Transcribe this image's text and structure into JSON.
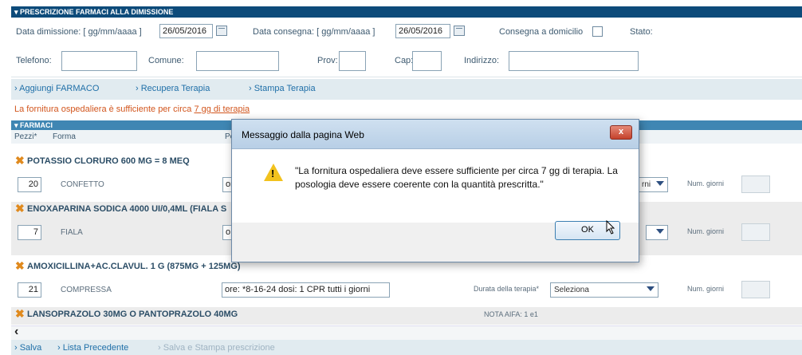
{
  "header": {
    "title": "▾ PRESCRIZIONE FARMACI ALLA DIMISSIONE"
  },
  "dimissione": {
    "data_dimissione_label": "Data dimissione: [ gg/mm/aaaa ]",
    "data_dimissione_value": "26/05/2016",
    "data_consegna_label": "Data consegna: [ gg/mm/aaaa ]",
    "data_consegna_value": "26/05/2016",
    "consegna_domicilio_label": "Consegna a domicilio",
    "stato_label": "Stato:",
    "telefono_label": "Telefono:",
    "comune_label": "Comune:",
    "prov_label": "Prov:",
    "cap_label": "Cap:",
    "indirizzo_label": "Indirizzo:"
  },
  "actions": {
    "aggiungi": "› Aggiungi FARMACO",
    "recupera": "› Recupera Terapia",
    "stampa": "› Stampa Terapia"
  },
  "warning": {
    "text": "La fornitura ospedaliera è sufficiente per circa ",
    "link": "7 gg di terapia"
  },
  "farmaci": {
    "section_title": "▾ FARMACI",
    "col_pezzi": "Pezzi*",
    "col_forma": "Forma",
    "col_po": "Po",
    "items": [
      {
        "name": "POTASSIO CLORURO 600 MG = 8 MEQ",
        "qty": "20",
        "form": "CONFETTO",
        "posologia": "ore",
        "select": ""
      },
      {
        "name": "ENOXAPARINA SODICA 4000 UI/0,4ML (FIALA S",
        "qty": "7",
        "form": "FIALA",
        "posologia": "o",
        "select": ""
      },
      {
        "name": "AMOXICILLINA+AC.CLAVUL. 1 G (875MG + 125MG)",
        "qty": "21",
        "form": "COMPRESSA",
        "posologia": "ore: *8-16-24 dosi: 1 CPR tutti i giorni",
        "durata_label": "Durata della terapia*",
        "select": "Seleziona"
      },
      {
        "name": "LANSOPRAZOLO 30MG O PANTOPRAZOLO 40MG",
        "nota": "NOTA AIFA: 1 e1"
      }
    ],
    "numgiorni_label": "Num. giorni",
    "sel_short": "rni"
  },
  "scroll": {
    "left_arrow": "‹"
  },
  "bottom": {
    "salva": "› Salva",
    "lista": "› Lista Precedente",
    "salva_stampa": "› Salva e Stampa prescrizione"
  },
  "dialog": {
    "title": "Messaggio dalla pagina Web",
    "close": "x",
    "message": "\"La fornitura ospedaliera deve essere sufficiente per circa 7 gg di terapia. La posologia deve essere coerente con la quantità prescritta.\"",
    "ok": "OK"
  },
  "colors": {
    "header": "#0d4b7a",
    "section": "#3f86b3",
    "warning": "#d2561e",
    "link": "#1f6fa8"
  }
}
